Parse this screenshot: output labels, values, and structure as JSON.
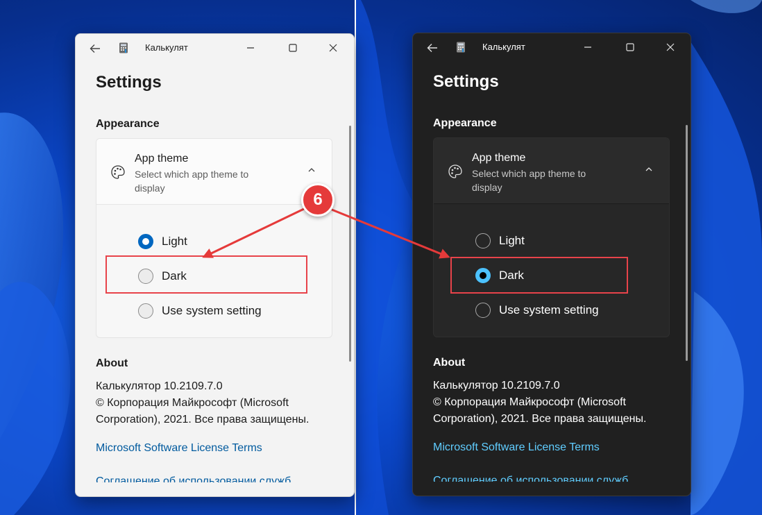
{
  "windows": {
    "light": {
      "title": "Калькулят",
      "heading": "Settings",
      "appearance_label": "Appearance",
      "app_theme": {
        "title": "App theme",
        "description": "Select which app theme to display",
        "options": [
          "Light",
          "Dark",
          "Use system setting"
        ],
        "selected": "Light"
      },
      "about_label": "About",
      "about_lines": {
        "version": "Калькулятор 10.2109.7.0",
        "copyright": "© Корпорация Майкрософт (Microsoft Corporation), 2021. Все права защищены."
      },
      "link_license": "Microsoft Software License Terms",
      "link_services": "Соглашение об использовании служб"
    },
    "dark": {
      "title": "Калькулят",
      "heading": "Settings",
      "appearance_label": "Appearance",
      "app_theme": {
        "title": "App theme",
        "description": "Select which app theme to display",
        "options": [
          "Light",
          "Dark",
          "Use system setting"
        ],
        "selected": "Dark"
      },
      "about_label": "About",
      "about_lines": {
        "version": "Калькулятор 10.2109.7.0",
        "copyright": "© Корпорация Майкрософт (Microsoft Corporation), 2021. Все права защищены."
      },
      "link_license": "Microsoft Software License Terms",
      "link_services": "Соглашение об использовании служб"
    }
  },
  "annotation": {
    "step_number": "6",
    "color": "#e53a3a"
  },
  "colors": {
    "light_accent": "#0067c0",
    "dark_accent": "#4cc2ff"
  },
  "icons": [
    "back-arrow-icon",
    "calculator-icon",
    "minimize-icon",
    "maximize-icon",
    "close-icon",
    "palette-icon",
    "chevron-up-icon"
  ]
}
